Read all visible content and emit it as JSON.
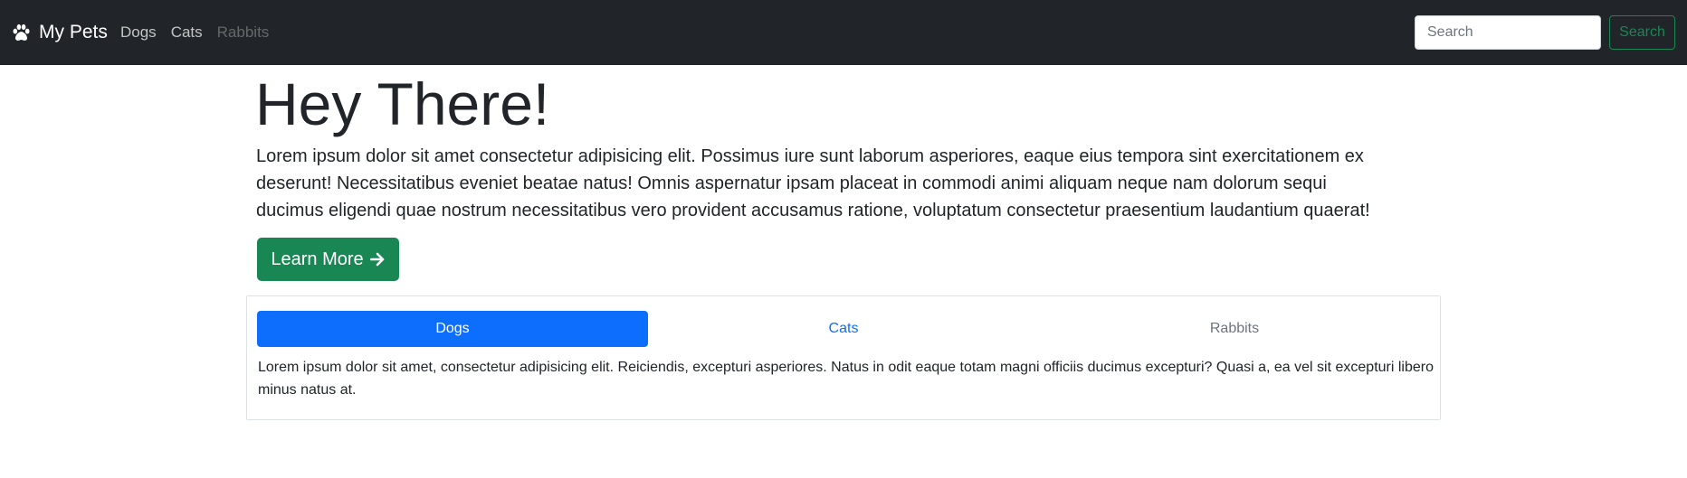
{
  "navbar": {
    "brand": "My Pets",
    "brand_icon": "paw-icon",
    "links": [
      {
        "label": "Dogs",
        "state": "normal"
      },
      {
        "label": "Cats",
        "state": "normal"
      },
      {
        "label": "Rabbits",
        "state": "disabled"
      }
    ],
    "search_placeholder": "Search",
    "search_value": "",
    "search_button": "Search"
  },
  "hero": {
    "title": "Hey There!",
    "lead": "Lorem ipsum dolor sit amet consectetur adipisicing elit. Possimus iure sunt laborum asperiores, eaque eius tempora sint exercitationem ex deserunt! Necessitatibus eveniet beatae natus! Omnis aspernatur ipsam placeat in commodi animi aliquam neque nam dolorum sequi ducimus eligendi quae nostrum necessitatibus vero provident accusamus ratione, voluptatum consectetur praesentium laudantium quaerat!",
    "button_label": "Learn More",
    "button_icon": "arrow-right-icon"
  },
  "tabs": {
    "items": [
      {
        "label": "Dogs",
        "state": "active"
      },
      {
        "label": "Cats",
        "state": "normal"
      },
      {
        "label": "Rabbits",
        "state": "disabled"
      }
    ],
    "content": "Lorem ipsum dolor sit amet, consectetur adipisicing elit. Reiciendis, excepturi asperiores. Natus in odit eaque totam magni officiis ducimus excepturi? Quasi a, ea vel sit excepturi libero minus natus at."
  },
  "colors": {
    "navbar_bg": "#212529",
    "success": "#198754",
    "primary": "#0d6efd",
    "muted": "#6c757d"
  }
}
